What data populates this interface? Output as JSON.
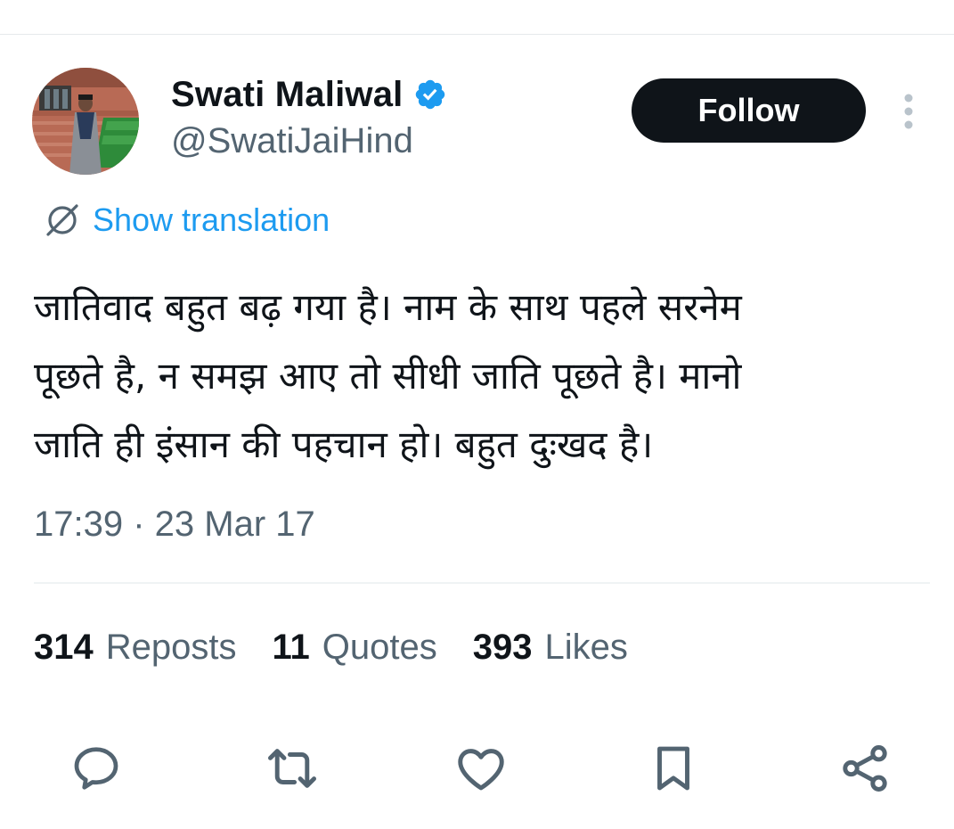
{
  "author": {
    "display_name": "Swati Maliwal",
    "handle": "@SwatiJaiHind",
    "verified": true,
    "verified_color": "#1d9bf0"
  },
  "follow_button": {
    "label": "Follow",
    "bg_color": "#0f1419"
  },
  "translation": {
    "label": "Show translation",
    "icon": "translate-icon",
    "color": "#1d9bf0"
  },
  "tweet": {
    "lines": [
      "जातिवाद बहुत बढ़ गया है। नाम के साथ पहले सरनेम",
      "पूछते है, न समझ आए तो सीधी जाति पूछते है। मानो",
      "जाति ही इंसान की पहचान हो। बहुत दुःखद है।"
    ],
    "timestamp": "17:39 · 23 Mar 17"
  },
  "stats": {
    "reposts": {
      "count": "314",
      "label": "Reposts"
    },
    "quotes": {
      "count": "11",
      "label": "Quotes"
    },
    "likes": {
      "count": "393",
      "label": "Likes"
    }
  },
  "actions": [
    {
      "name": "reply",
      "icon": "reply-icon"
    },
    {
      "name": "repost",
      "icon": "repost-icon"
    },
    {
      "name": "like",
      "icon": "heart-icon"
    },
    {
      "name": "bookmark",
      "icon": "bookmark-icon"
    },
    {
      "name": "share",
      "icon": "share-icon"
    }
  ]
}
